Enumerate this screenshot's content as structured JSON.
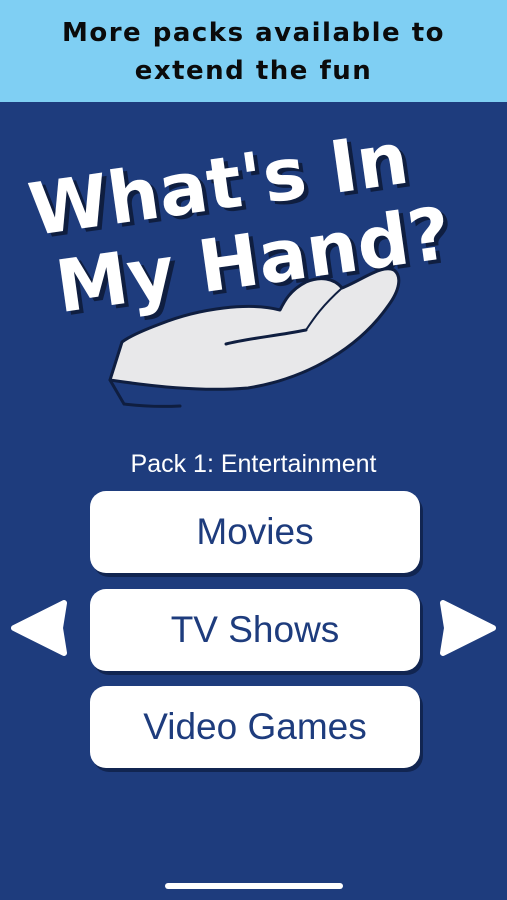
{
  "banner": {
    "line1": "More packs available to",
    "line2": "extend the fun"
  },
  "title": {
    "line1": "What's In",
    "line2": "My Hand?"
  },
  "hand_icon": "open-palm-hand-icon",
  "pack": {
    "label": "Pack 1: Entertainment"
  },
  "categories": [
    {
      "label": "Movies"
    },
    {
      "label": "TV Shows"
    },
    {
      "label": "Video Games"
    }
  ],
  "navigation": {
    "prev_icon": "triangle-left-icon",
    "next_icon": "triangle-right-icon"
  },
  "colors": {
    "background": "#1e3c7d",
    "banner": "#7fcff3",
    "button": "#ffffff",
    "button_text": "#1e3c7d"
  }
}
